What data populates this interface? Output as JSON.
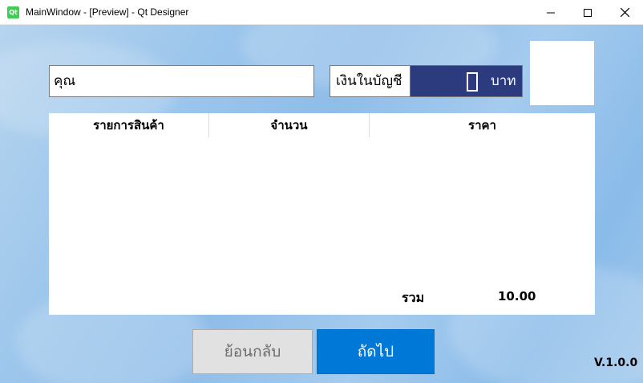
{
  "window": {
    "title": "MainWindow - [Preview] - Qt Designer",
    "logo_text": "Qt",
    "minimize_icon": "minimize-icon",
    "maximize_icon": "maximize-icon",
    "close_icon": "close-icon"
  },
  "customer": {
    "name_value": "คุณ"
  },
  "balance": {
    "label": "เงินในบัญชี",
    "value": "0",
    "unit": "บาท"
  },
  "table": {
    "columns": [
      "รายการสินค้า",
      "จำนวน",
      "ราคา"
    ],
    "rows": [],
    "total_label": "รวม",
    "total_value": "10.00"
  },
  "buttons": {
    "back": "ย้อนกลับ",
    "next": "ถัดไป"
  },
  "version": "V.1.0.0",
  "colors": {
    "lcd_background": "#2b3b7e",
    "next_button": "#0078d7",
    "back_button": "#e1e1e1"
  }
}
